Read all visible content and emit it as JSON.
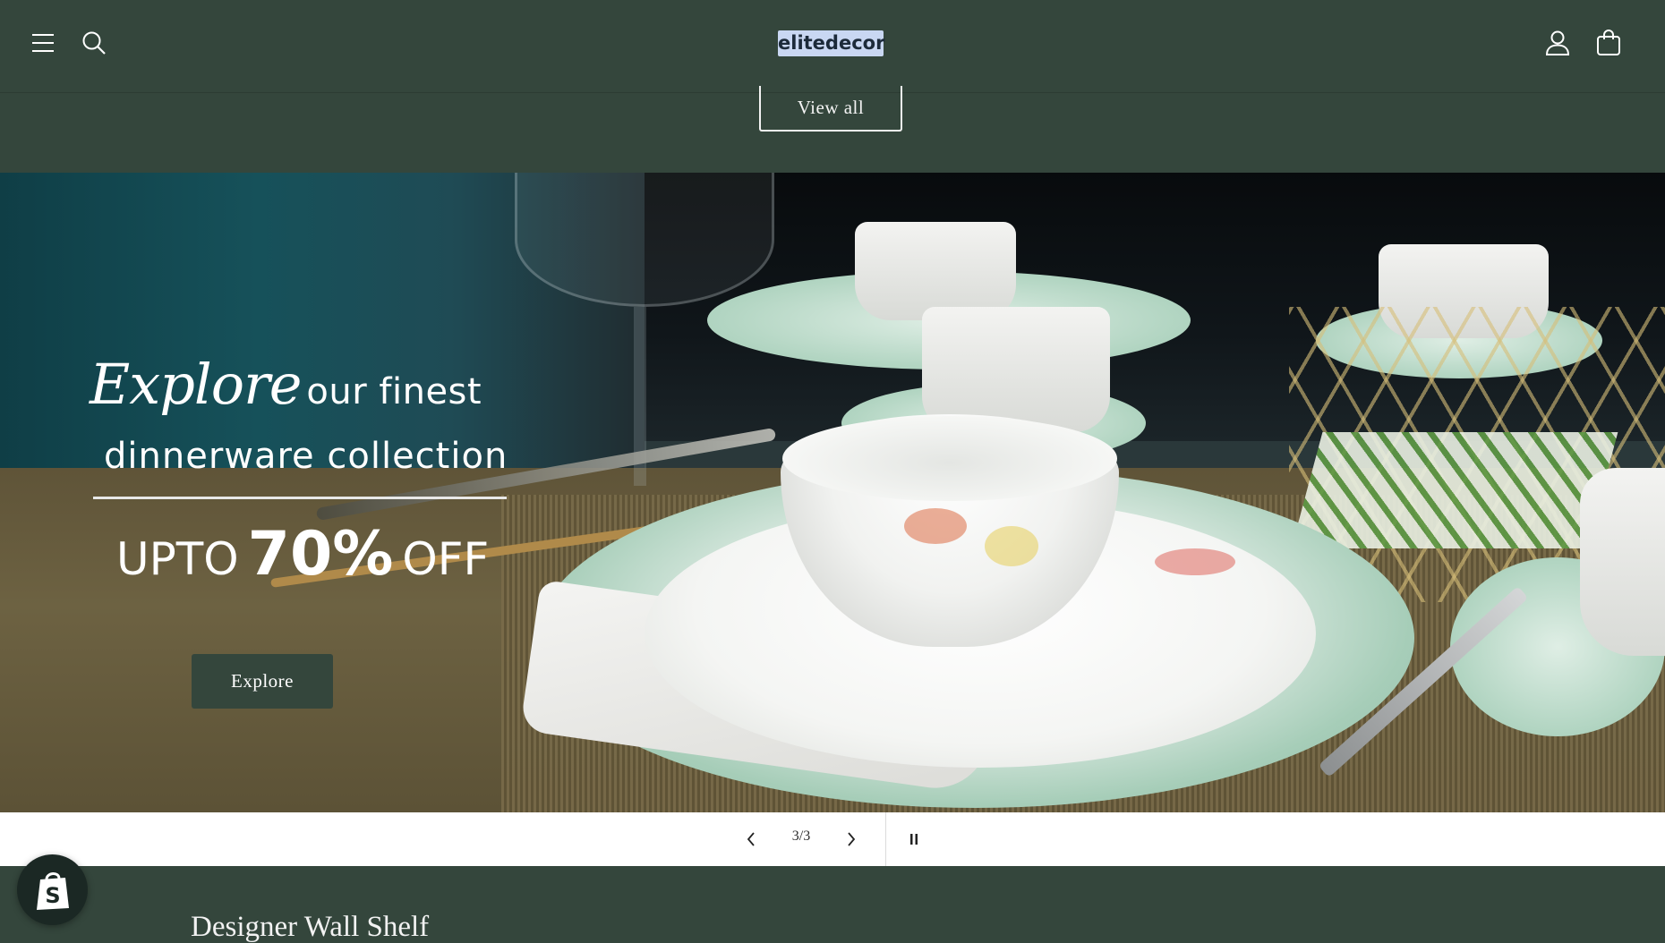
{
  "header": {
    "logo_text": "elitedecor",
    "menu_icon": "hamburger-menu-icon",
    "search_icon": "search-icon",
    "account_icon": "user-account-icon",
    "cart_icon": "shopping-bag-icon"
  },
  "collection": {
    "view_all_label": "View all"
  },
  "hero": {
    "headline_script": "Explore",
    "headline_rest": "our finest",
    "headline_line2": "dinnerware collection",
    "offer_upto": "UPTO",
    "offer_percent": "70%",
    "offer_off": "OFF",
    "cta_label": "Explore"
  },
  "slider": {
    "counter": "3/3",
    "prev_icon": "chevron-left-icon",
    "next_icon": "chevron-right-icon",
    "pause_icon": "pause-icon"
  },
  "next_section": {
    "title": "Designer Wall Shelf"
  },
  "shop_badge": {
    "icon": "shopify-bag-icon",
    "letter": "S"
  },
  "colors": {
    "brand_green": "#34463c",
    "logo_bg": "#c9d7f2",
    "white": "#ffffff"
  }
}
